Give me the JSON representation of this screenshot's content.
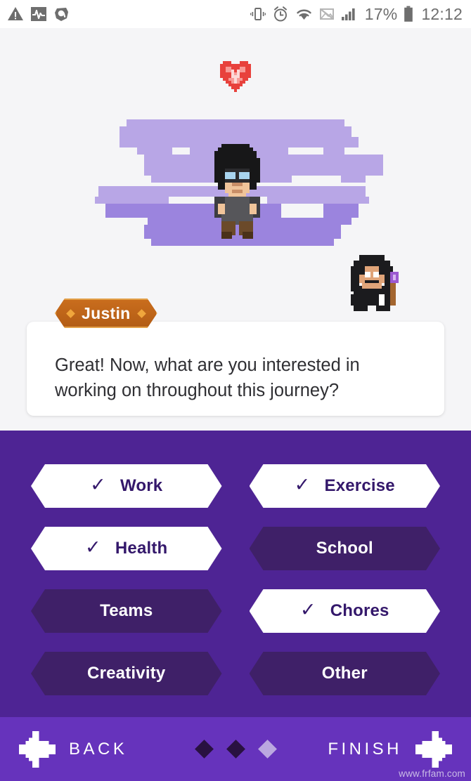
{
  "statusbar": {
    "left_icons": [
      "warning-triangle-icon",
      "activity-monitor-icon",
      "avast-shield-icon"
    ],
    "right_icons": [
      "vibrate-icon",
      "alarm-clock-icon",
      "wifi-icon",
      "no-sim-icon",
      "signal-bars-icon",
      "battery-icon"
    ],
    "battery_percent": "17%",
    "clock": "12:12"
  },
  "scene": {
    "pet_icon": "red-heart-gem-icon",
    "avatar_icon": "player-avatar-pixel",
    "npc_icon": "npc-mage-pixel"
  },
  "dialog": {
    "speaker": "Justin",
    "message": "Great! Now, what are you interested in working on throughout this journey?"
  },
  "options": {
    "items": [
      {
        "label": "Work",
        "selected": true
      },
      {
        "label": "Exercise",
        "selected": true
      },
      {
        "label": "Health",
        "selected": true
      },
      {
        "label": "School",
        "selected": false
      },
      {
        "label": "Teams",
        "selected": false
      },
      {
        "label": "Chores",
        "selected": true
      },
      {
        "label": "Creativity",
        "selected": false
      },
      {
        "label": "Other",
        "selected": false
      }
    ],
    "check_glyph": "✓"
  },
  "bottomnav": {
    "back_label": "BACK",
    "finish_label": "FINISH",
    "back_icon": "arrow-left-pixel-icon",
    "finish_icon": "arrow-right-pixel-icon",
    "pages": [
      "past",
      "past",
      "current"
    ],
    "watermark": "www.frfam.com"
  },
  "colors": {
    "panel_purple": "#4E2494",
    "nav_purple": "#6633BC",
    "option_off": "#3F2068",
    "option_on_text": "#34186B",
    "nametag_orange": "#C0661B",
    "scene_bg": "#F5F5F7",
    "cloud_light": "#B8A6E6",
    "cloud_dark": "#9B84DE",
    "dot_past": "#291141",
    "dot_current": "#BBA8E0"
  }
}
